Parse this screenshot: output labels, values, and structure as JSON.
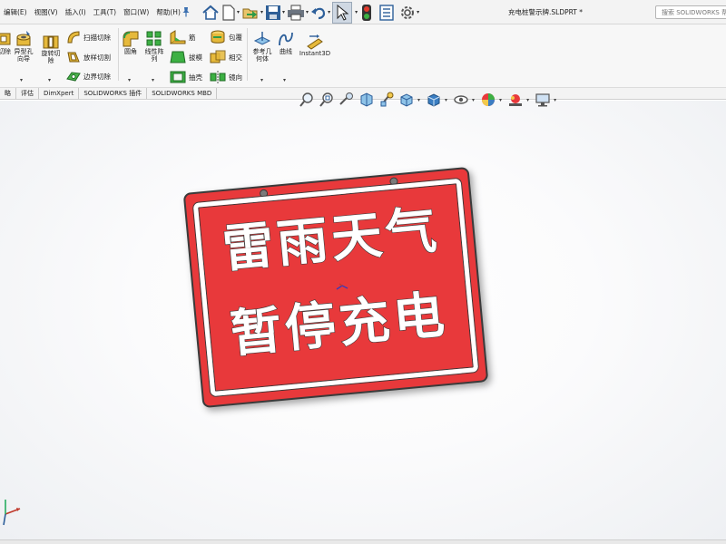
{
  "menu": {
    "items": [
      "编辑(E)",
      "视图(V)",
      "插入(I)",
      "工具(T)",
      "窗口(W)",
      "帮助(H)"
    ]
  },
  "quick_access": {
    "icons": [
      "home-icon",
      "new-document-icon",
      "open-icon",
      "save-icon",
      "print-icon",
      "undo-icon",
      "select-icon",
      "rebuild-icon",
      "file-properties-icon",
      "options-icon"
    ]
  },
  "document": {
    "title": "充电桩警示牌.SLDPRT *"
  },
  "search": {
    "placeholder": "搜索 SOLIDWORKS 帮助"
  },
  "ribbon": {
    "cut_extrude": "切除",
    "hole_wizard": "异型孔\n向导",
    "revolve_cut": "旋转切\n除",
    "sweep_cut": "扫描切除",
    "loft_cut": "放样切割",
    "boundary_cut": "边界切除",
    "fillet": "圆角",
    "linear_pattern": "线性阵\n列",
    "rib": "筋",
    "draft": "拔模",
    "shell": "抽壳",
    "wrap": "包覆",
    "intersect": "相交",
    "mirror": "镜向",
    "reference_geometry": "参考几\n何体",
    "curves": "曲线",
    "instant3d": "Instant3D"
  },
  "tabs": [
    "略",
    "评估",
    "DimXpert",
    "SOLIDWORKS 插件",
    "SOLIDWORKS MBD"
  ],
  "model": {
    "line1": "雷雨天气",
    "line2": "暂停充电",
    "face_color": "#e8393b",
    "border_color": "#ffffff"
  },
  "heads_up_view": {
    "icons": [
      "zoom-to-fit-icon",
      "zoom-area-icon",
      "previous-view-icon",
      "section-view-icon",
      "dynamic-annotation-icon",
      "view-orientation-icon",
      "display-style-icon",
      "hide-show-items-icon",
      "edit-appearance-icon",
      "apply-scene-icon",
      "view-settings-icon"
    ]
  }
}
